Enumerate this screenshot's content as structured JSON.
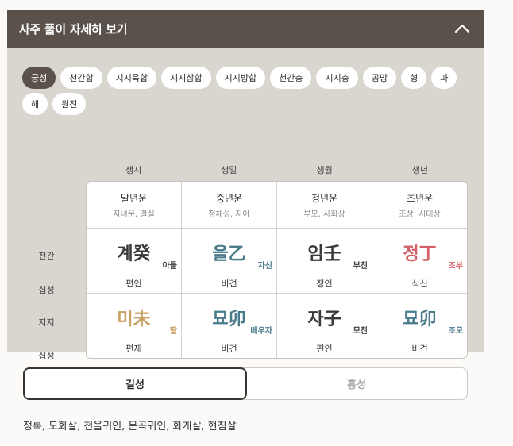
{
  "header": {
    "title": "사주 풀이 자세히 보기"
  },
  "chips": [
    {
      "label": "궁성",
      "active": true
    },
    {
      "label": "천간합",
      "active": false
    },
    {
      "label": "지지육합",
      "active": false
    },
    {
      "label": "지지삼합",
      "active": false
    },
    {
      "label": "지지방합",
      "active": false
    },
    {
      "label": "천간충",
      "active": false
    },
    {
      "label": "지지충",
      "active": false
    },
    {
      "label": "공망",
      "active": false
    },
    {
      "label": "형",
      "active": false
    },
    {
      "label": "파",
      "active": false
    },
    {
      "label": "해",
      "active": false
    },
    {
      "label": "원진",
      "active": false
    }
  ],
  "columns": [
    "생시",
    "생일",
    "생월",
    "생년"
  ],
  "row_labels": [
    "천간",
    "십성",
    "지지",
    "십성"
  ],
  "periods": [
    {
      "title": "말년운",
      "sub": "자녀운, 결실"
    },
    {
      "title": "중년운",
      "sub": "정체성, 자아"
    },
    {
      "title": "청년운",
      "sub": "부모, 사회상"
    },
    {
      "title": "초년운",
      "sub": "조상, 시대상"
    }
  ],
  "stems": [
    {
      "text": "계癸",
      "relation": "아들",
      "color": "#3a3a3a"
    },
    {
      "text": "을乙",
      "relation": "자신",
      "color": "#4a7c8c"
    },
    {
      "text": "임壬",
      "relation": "부친",
      "color": "#3a3a3a"
    },
    {
      "text": "정丁",
      "relation": "조부",
      "color": "#d26066"
    }
  ],
  "stem_tengods": [
    "편인",
    "비견",
    "정인",
    "식신"
  ],
  "branches": [
    {
      "text": "미未",
      "relation": "딸",
      "color": "#c8a064"
    },
    {
      "text": "묘卯",
      "relation": "배우자",
      "color": "#4a7c8c"
    },
    {
      "text": "자子",
      "relation": "모친",
      "color": "#3a3a3a"
    },
    {
      "text": "묘卯",
      "relation": "조모",
      "color": "#4a7c8c"
    }
  ],
  "branch_tengods": [
    "편재",
    "비견",
    "편인",
    "비견"
  ],
  "toggle": {
    "good": "길성",
    "bad": "흉성"
  },
  "result_text": "정록, 도화살, 천을귀인, 문곡귀인, 화개살, 현침살"
}
